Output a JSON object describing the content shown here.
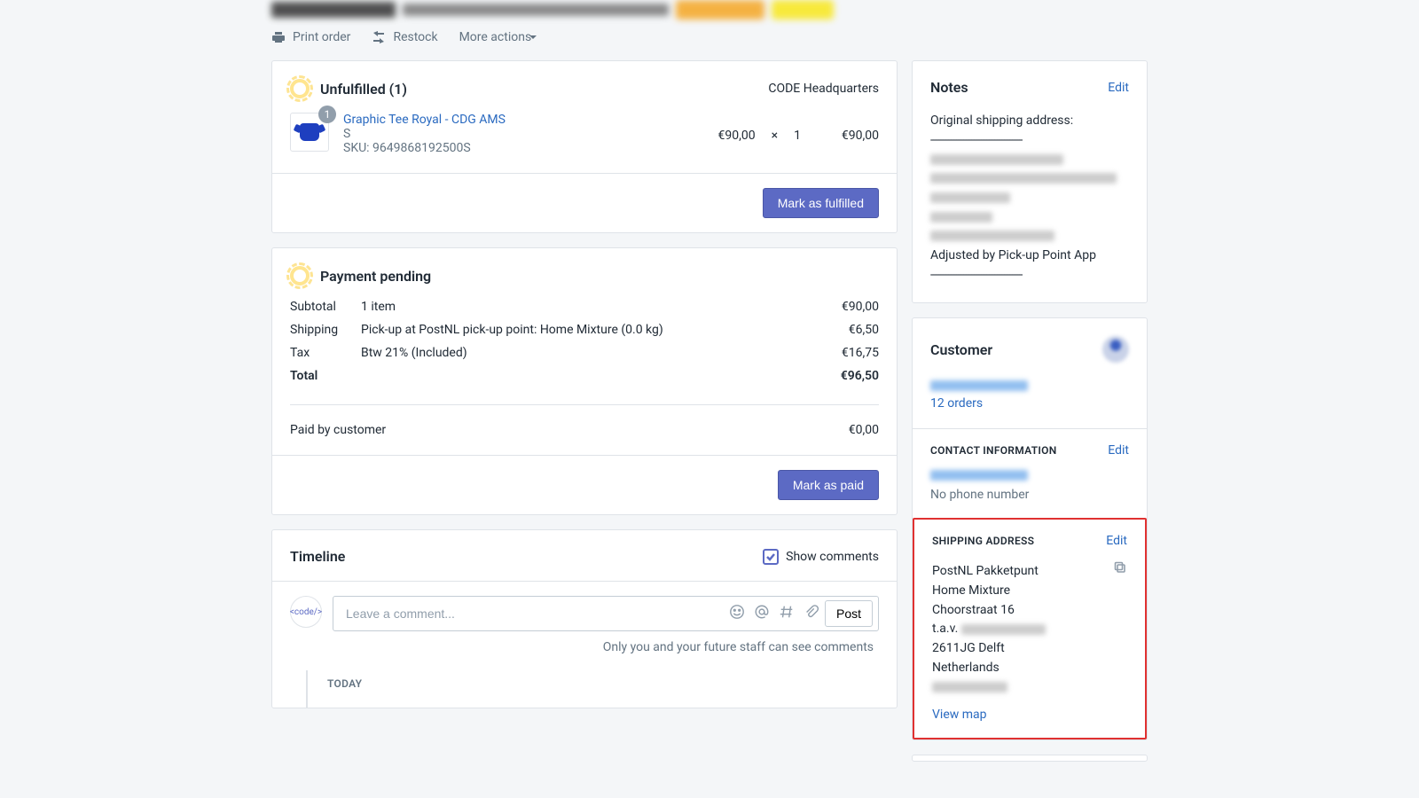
{
  "actions": {
    "print": "Print order",
    "restock": "Restock",
    "more": "More actions"
  },
  "fulfillment": {
    "title": "Unfulfilled (1)",
    "location": "CODE Headquarters",
    "item": {
      "qty": "1",
      "name": "Graphic Tee Royal - CDG AMS",
      "variant": "S",
      "sku": "SKU: 9649868192500S",
      "unit": "€90,00",
      "mult": "×",
      "count": "1",
      "total": "€90,00"
    },
    "button": "Mark as fulfilled"
  },
  "payment": {
    "title": "Payment pending",
    "rows": {
      "subtotal_lbl": "Subtotal",
      "subtotal_desc": "1 item",
      "subtotal_val": "€90,00",
      "shipping_lbl": "Shipping",
      "shipping_desc": "Pick-up at PostNL pick-up point: Home Mixture (0.0 kg)",
      "shipping_val": "€6,50",
      "tax_lbl": "Tax",
      "tax_desc": "Btw 21% (Included)",
      "tax_val": "€16,75",
      "total_lbl": "Total",
      "total_val": "€96,50",
      "paid_lbl": "Paid by customer",
      "paid_val": "€0,00"
    },
    "button": "Mark as paid"
  },
  "timeline": {
    "title": "Timeline",
    "show_comments": "Show comments",
    "avatar": "<code/>",
    "placeholder": "Leave a comment...",
    "post": "Post",
    "note": "Only you and your future staff can see comments",
    "today": "TODAY"
  },
  "notes": {
    "title": "Notes",
    "edit": "Edit",
    "line1": "Original shipping address:",
    "dashes": "------------------------------------",
    "adjusted": "Adjusted by Pick-up Point App"
  },
  "customer": {
    "title": "Customer",
    "orders": "12 orders"
  },
  "contact": {
    "title": "CONTACT INFORMATION",
    "edit": "Edit",
    "no_phone": "No phone number"
  },
  "shipping": {
    "title": "SHIPPING ADDRESS",
    "edit": "Edit",
    "l1": "PostNL Pakketpunt",
    "l2": "Home Mixture",
    "l3": "Choorstraat 16",
    "l4_prefix": "t.a.v.",
    "l5": "2611JG Delft",
    "l6": "Netherlands",
    "view_map": "View map"
  }
}
